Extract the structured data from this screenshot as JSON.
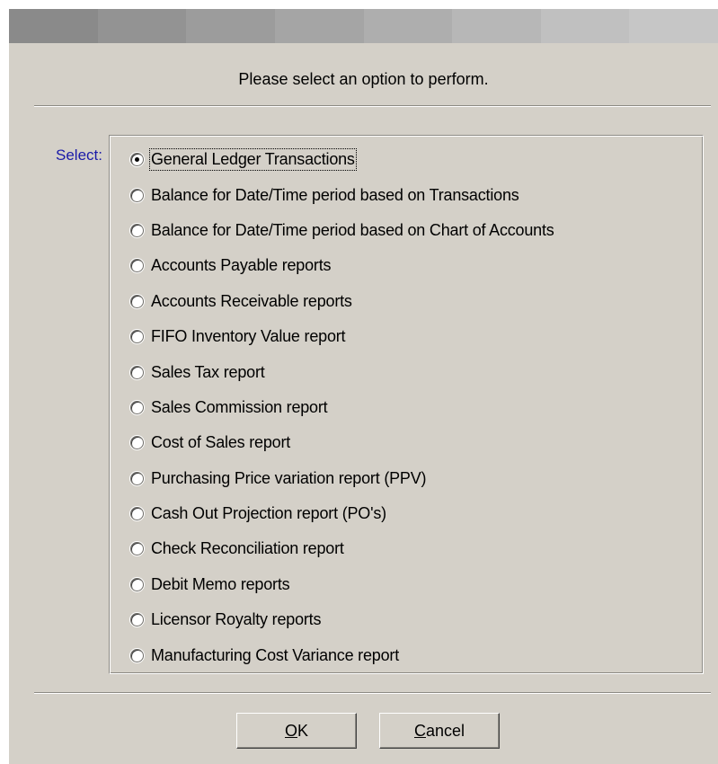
{
  "colors": {
    "dialog_bg": "#d4d0c8",
    "title_strip": [
      "#8a8a8a",
      "#939393",
      "#9c9c9c",
      "#a5a5a5",
      "#aeaeae",
      "#b7b7b7",
      "#c0c0c0",
      "#c6c6c6"
    ],
    "select_label": "#1a1aa8"
  },
  "prompt": "Please select an option to perform.",
  "select_label": "Select:",
  "options": [
    {
      "label": "General Ledger Transactions",
      "checked": true
    },
    {
      "label": "Balance for Date/Time period based on Transactions",
      "checked": false
    },
    {
      "label": "Balance for Date/Time period based on Chart of Accounts",
      "checked": false
    },
    {
      "label": "Accounts Payable reports",
      "checked": false
    },
    {
      "label": "Accounts Receivable reports",
      "checked": false
    },
    {
      "label": "FIFO Inventory Value report",
      "checked": false
    },
    {
      "label": "Sales Tax report",
      "checked": false
    },
    {
      "label": "Sales Commission report",
      "checked": false
    },
    {
      "label": "Cost of Sales report",
      "checked": false
    },
    {
      "label": "Purchasing Price variation report (PPV)",
      "checked": false
    },
    {
      "label": "Cash Out Projection report (PO's)",
      "checked": false
    },
    {
      "label": "Check Reconciliation report",
      "checked": false
    },
    {
      "label": "Debit Memo reports",
      "checked": false
    },
    {
      "label": "Licensor Royalty reports",
      "checked": false
    },
    {
      "label": "Manufacturing Cost Variance report",
      "checked": false
    }
  ],
  "buttons": {
    "ok": {
      "mnemonic": "O",
      "rest": "K"
    },
    "cancel": {
      "mnemonic": "C",
      "rest": "ancel"
    }
  }
}
